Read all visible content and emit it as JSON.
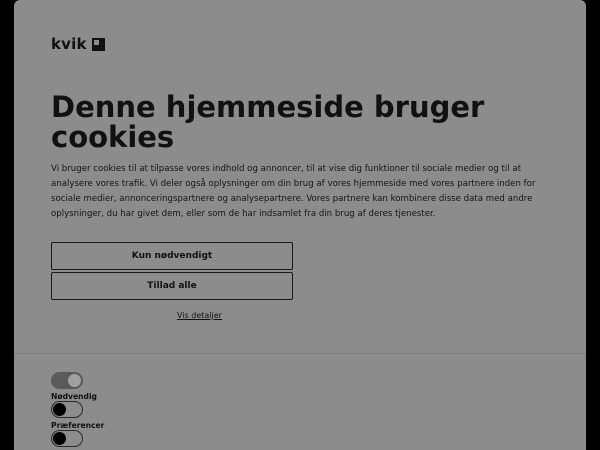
{
  "brand": {
    "name": "kvik"
  },
  "banner": {
    "title": "Denne hjemmeside bruger cookies",
    "description": "Vi bruger cookies til at tilpasse vores indhold og annoncer, til at vise dig funktioner til sociale medier og til at analysere vores trafik. Vi deler også oplysninger om din brug af vores hjemmeside med vores partnere inden for sociale medier, annonceringspartnere og analysepartnere. Vores partnere kan kombinere disse data med andre oplysninger, du har givet dem, eller som de har indsamlet fra din brug af deres tjenester.",
    "buttons": {
      "necessary_only": "Kun nødvendigt",
      "allow_all": "Tillad alle"
    },
    "details_link": "Vis detaljer"
  },
  "consent_toggles": [
    {
      "label": "Nødvendig",
      "state": "on"
    },
    {
      "label": "Præferencer",
      "state": "off"
    },
    {
      "label": "",
      "state": "off"
    }
  ],
  "colors": {
    "page_background": "#000000",
    "modal_background": "#8c8c8c",
    "text": "#111111"
  }
}
